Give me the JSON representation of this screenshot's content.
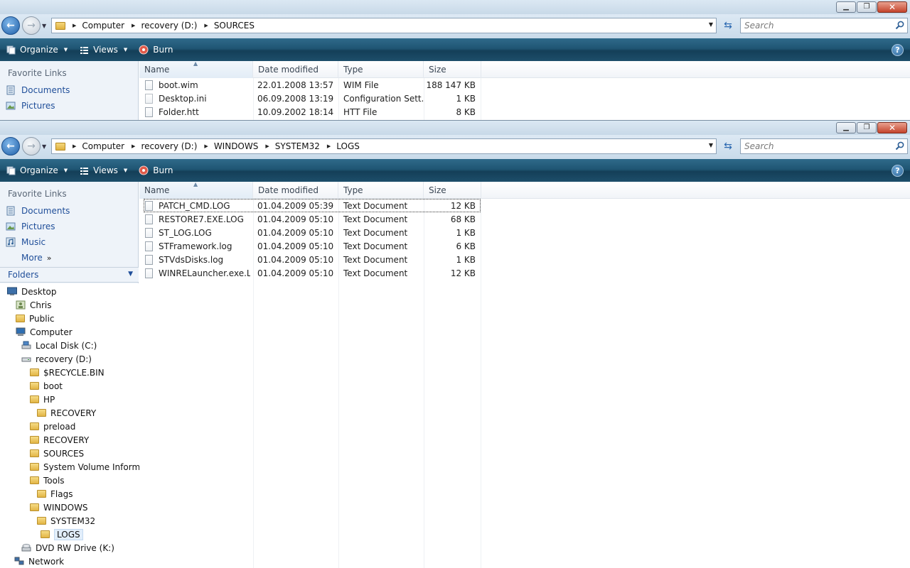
{
  "colors": {
    "command_bar": "#1f5573",
    "link": "#1f4e99",
    "caption": "#c8d9e8"
  },
  "window_top": {
    "caption_buttons": [
      "minimize",
      "maximize",
      "close"
    ],
    "address": {
      "crumbs": [
        "Computer",
        "recovery (D:)",
        "SOURCES"
      ]
    },
    "search": {
      "placeholder": "Search"
    },
    "toolbar": {
      "organize": "Organize",
      "views": "Views",
      "burn": "Burn"
    },
    "nav": {
      "favorites_header": "Favorite Links",
      "items": [
        "Documents",
        "Pictures"
      ]
    },
    "columns": {
      "name": "Name",
      "date": "Date modified",
      "type": "Type",
      "size": "Size"
    },
    "files": [
      {
        "name": "boot.wim",
        "date": "22.01.2008 13:57",
        "type": "WIM File",
        "size": "188 147 KB"
      },
      {
        "name": "Desktop.ini",
        "date": "06.09.2008 13:19",
        "type": "Configuration Sett...",
        "size": "1 KB"
      },
      {
        "name": "Folder.htt",
        "date": "10.09.2002 18:14",
        "type": "HTT File",
        "size": "8 KB"
      }
    ]
  },
  "window_bottom": {
    "address": {
      "crumbs": [
        "Computer",
        "recovery (D:)",
        "WINDOWS",
        "SYSTEM32",
        "LOGS"
      ]
    },
    "search": {
      "placeholder": "Search"
    },
    "toolbar": {
      "organize": "Organize",
      "views": "Views",
      "burn": "Burn"
    },
    "nav": {
      "favorites_header": "Favorite Links",
      "items": [
        "Documents",
        "Pictures",
        "Music"
      ],
      "more": "More",
      "folders_header": "Folders"
    },
    "tree": [
      {
        "label": "Desktop",
        "icon": "desktop-icon"
      },
      {
        "label": "Chris",
        "icon": "user-folder-icon"
      },
      {
        "label": "Public",
        "icon": "folder-icon"
      },
      {
        "label": "Computer",
        "icon": "computer-icon"
      },
      {
        "label": "Local Disk (C:)",
        "icon": "hard-drive-icon"
      },
      {
        "label": "recovery (D:)",
        "icon": "drive-icon"
      },
      {
        "label": "$RECYCLE.BIN",
        "icon": "folder-icon"
      },
      {
        "label": "boot",
        "icon": "folder-icon"
      },
      {
        "label": "HP",
        "icon": "folder-icon"
      },
      {
        "label": "RECOVERY",
        "icon": "folder-icon"
      },
      {
        "label": "preload",
        "icon": "folder-icon"
      },
      {
        "label": "RECOVERY",
        "icon": "folder-icon"
      },
      {
        "label": "SOURCES",
        "icon": "folder-icon"
      },
      {
        "label": "System Volume Informat",
        "icon": "folder-icon"
      },
      {
        "label": "Tools",
        "icon": "folder-icon"
      },
      {
        "label": "Flags",
        "icon": "folder-icon"
      },
      {
        "label": "WINDOWS",
        "icon": "folder-icon"
      },
      {
        "label": "SYSTEM32",
        "icon": "folder-icon"
      },
      {
        "label": "LOGS",
        "icon": "folder-icon",
        "selected": true
      },
      {
        "label": "DVD RW Drive (K:)",
        "icon": "dvd-drive-icon"
      },
      {
        "label": "Network",
        "icon": "network-icon"
      }
    ],
    "columns": {
      "name": "Name",
      "date": "Date modified",
      "type": "Type",
      "size": "Size"
    },
    "files": [
      {
        "name": "PATCH_CMD.LOG",
        "date": "01.04.2009 05:39",
        "type": "Text Document",
        "size": "12 KB"
      },
      {
        "name": "RESTORE7.EXE.LOG",
        "date": "01.04.2009 05:10",
        "type": "Text Document",
        "size": "68 KB"
      },
      {
        "name": "ST_LOG.LOG",
        "date": "01.04.2009 05:10",
        "type": "Text Document",
        "size": "1 KB"
      },
      {
        "name": "STFramework.log",
        "date": "01.04.2009 05:10",
        "type": "Text Document",
        "size": "6 KB"
      },
      {
        "name": "STVdsDisks.log",
        "date": "01.04.2009 05:10",
        "type": "Text Document",
        "size": "1 KB"
      },
      {
        "name": "WINRELauncher.exe.L...",
        "date": "01.04.2009 05:10",
        "type": "Text Document",
        "size": "12 KB"
      }
    ]
  }
}
